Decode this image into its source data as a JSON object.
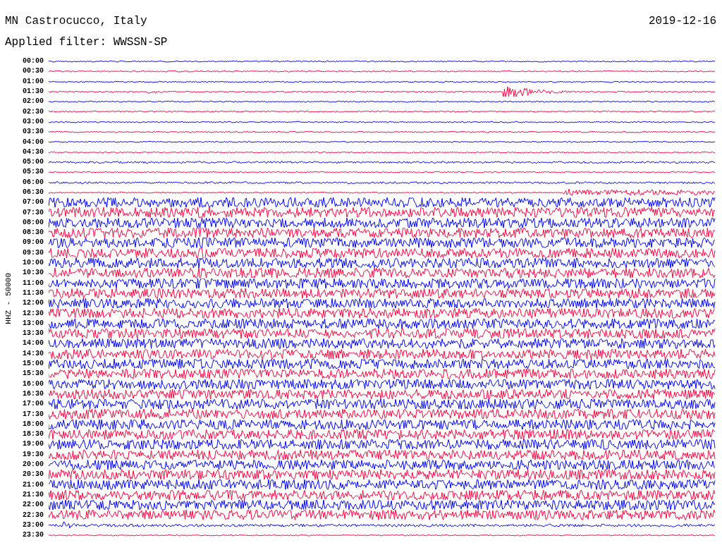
{
  "header": {
    "station": "MN Castrocucco, Italy",
    "date": "2019-12-16",
    "filter": "Applied filter: WWSSN-SP"
  },
  "axis_label": "HHZ - 50000",
  "traces": [
    {
      "time": "00:00",
      "color": "#0000ff"
    },
    {
      "time": "00:30",
      "color": "#ff0040"
    },
    {
      "time": "01:00",
      "color": "#0000ff"
    },
    {
      "time": "01:30",
      "color": "#ff0040"
    },
    {
      "time": "02:00",
      "color": "#0000ff"
    },
    {
      "time": "02:30",
      "color": "#ff0040"
    },
    {
      "time": "03:00",
      "color": "#0000ff"
    },
    {
      "time": "03:30",
      "color": "#ff0040"
    },
    {
      "time": "04:00",
      "color": "#0000ff"
    },
    {
      "time": "04:30",
      "color": "#ff0040"
    },
    {
      "time": "05:00",
      "color": "#0000ff"
    },
    {
      "time": "05:30",
      "color": "#ff0040"
    },
    {
      "time": "06:00",
      "color": "#0000ff"
    },
    {
      "time": "06:30",
      "color": "#ff0040"
    },
    {
      "time": "07:00",
      "color": "#0000ff"
    },
    {
      "time": "07:30",
      "color": "#ff0040"
    },
    {
      "time": "08:00",
      "color": "#0000ff"
    },
    {
      "time": "08:30",
      "color": "#ff0040"
    },
    {
      "time": "09:00",
      "color": "#0000ff"
    },
    {
      "time": "09:30",
      "color": "#ff0040"
    },
    {
      "time": "10:00",
      "color": "#0000ff"
    },
    {
      "time": "10:30",
      "color": "#ff0040"
    },
    {
      "time": "11:00",
      "color": "#0000ff"
    },
    {
      "time": "11:30",
      "color": "#ff0040"
    },
    {
      "time": "12:00",
      "color": "#0000ff"
    },
    {
      "time": "12:30",
      "color": "#ff0040"
    },
    {
      "time": "13:00",
      "color": "#0000ff"
    },
    {
      "time": "13:30",
      "color": "#ff0040"
    },
    {
      "time": "14:00",
      "color": "#0000ff"
    },
    {
      "time": "14:30",
      "color": "#ff0040"
    },
    {
      "time": "15:00",
      "color": "#0000ff"
    },
    {
      "time": "15:30",
      "color": "#ff0040"
    },
    {
      "time": "16:00",
      "color": "#0000ff"
    },
    {
      "time": "16:30",
      "color": "#ff0040"
    },
    {
      "time": "17:00",
      "color": "#0000ff"
    },
    {
      "time": "17:30",
      "color": "#ff0040"
    },
    {
      "time": "18:00",
      "color": "#0000ff"
    },
    {
      "time": "18:30",
      "color": "#ff0040"
    },
    {
      "time": "19:00",
      "color": "#0000ff"
    },
    {
      "time": "19:30",
      "color": "#ff0040"
    },
    {
      "time": "20:00",
      "color": "#0000ff"
    },
    {
      "time": "20:30",
      "color": "#ff0040"
    },
    {
      "time": "21:00",
      "color": "#0000ff"
    },
    {
      "time": "21:30",
      "color": "#ff0040"
    },
    {
      "time": "22:00",
      "color": "#0000ff"
    },
    {
      "time": "22:30",
      "color": "#ff0040"
    },
    {
      "time": "23:00",
      "color": "#0000ff"
    },
    {
      "time": "23:30",
      "color": "#ff0040"
    }
  ]
}
